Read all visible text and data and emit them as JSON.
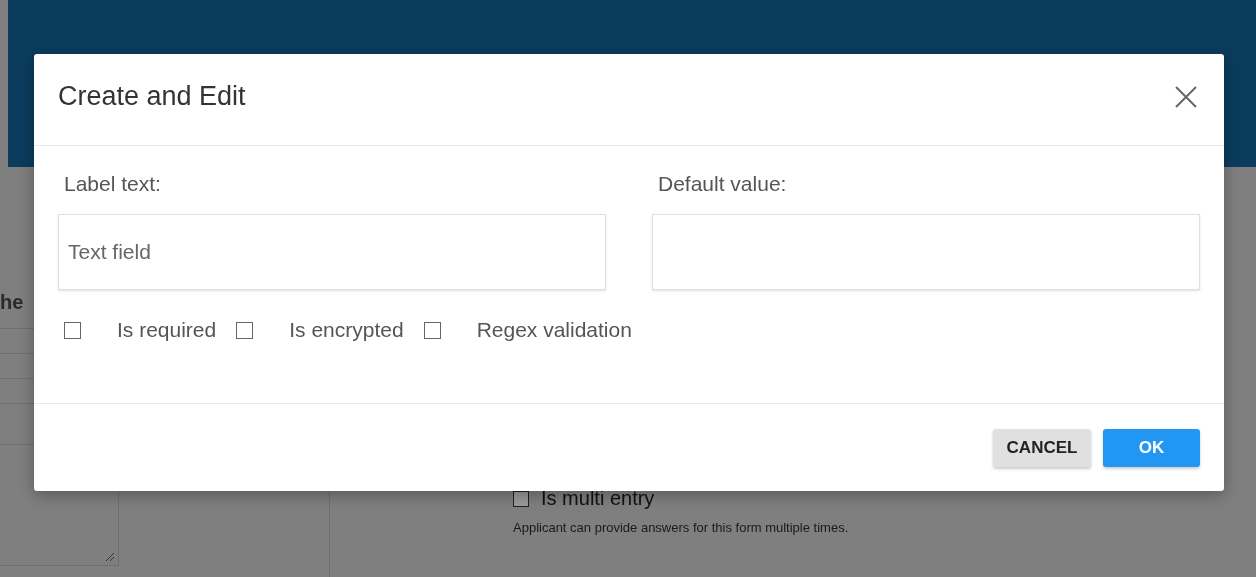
{
  "background": {
    "heading_fragment": "he",
    "multi_entry": {
      "label": "Is multi entry",
      "checked": false
    },
    "multi_entry_hint": "Applicant can provide answers for this form multiple times."
  },
  "dialog": {
    "title": "Create and Edit",
    "fields": [
      {
        "label": "Label text:",
        "value": "Text field"
      },
      {
        "label": "Default value:"
      }
    ],
    "options": [
      {
        "label": "Is required",
        "checked": false
      },
      {
        "label": "Is encrypted",
        "checked": false
      },
      {
        "label": "Regex validation",
        "checked": false
      }
    ],
    "buttons": [
      {
        "label": "CANCEL",
        "kind": "secondary"
      },
      {
        "label": "OK",
        "kind": "primary"
      }
    ]
  }
}
